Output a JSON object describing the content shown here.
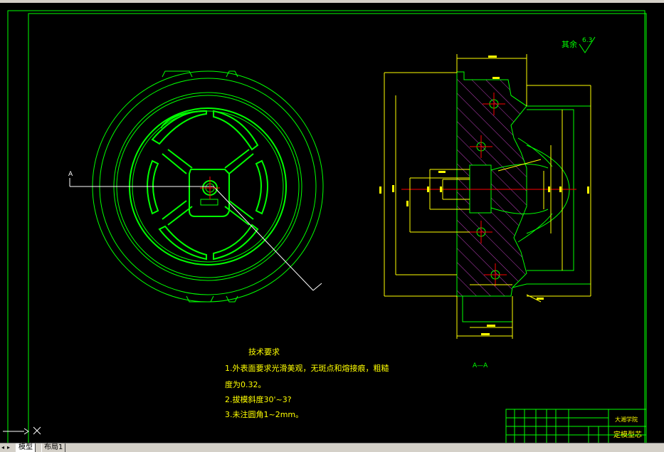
{
  "drawing": {
    "roughness_label": "其余",
    "roughness_value": "6.3",
    "section_label": "A—A",
    "section_marker": "A",
    "tech_title": "技术要求",
    "tech_lines": [
      "1.外表面要求光滑美观，无斑点和熔接痕，粗糙",
      "度为0.32。",
      "2.拔模斜度30'~3?",
      "3.未注圆角1~2mm。"
    ],
    "title_block": {
      "school": "大湘学院",
      "drawing_name": "定模型芯"
    }
  },
  "tabs": [
    {
      "label": "模型"
    },
    {
      "label": "布局1"
    }
  ],
  "colors": {
    "outline": "#00ff00",
    "dimension": "#ffff00",
    "centerline": "#ff0000",
    "hatch": "#c040c0",
    "text": "#ffff00",
    "label_green": "#00ff00",
    "background": "#000000"
  }
}
